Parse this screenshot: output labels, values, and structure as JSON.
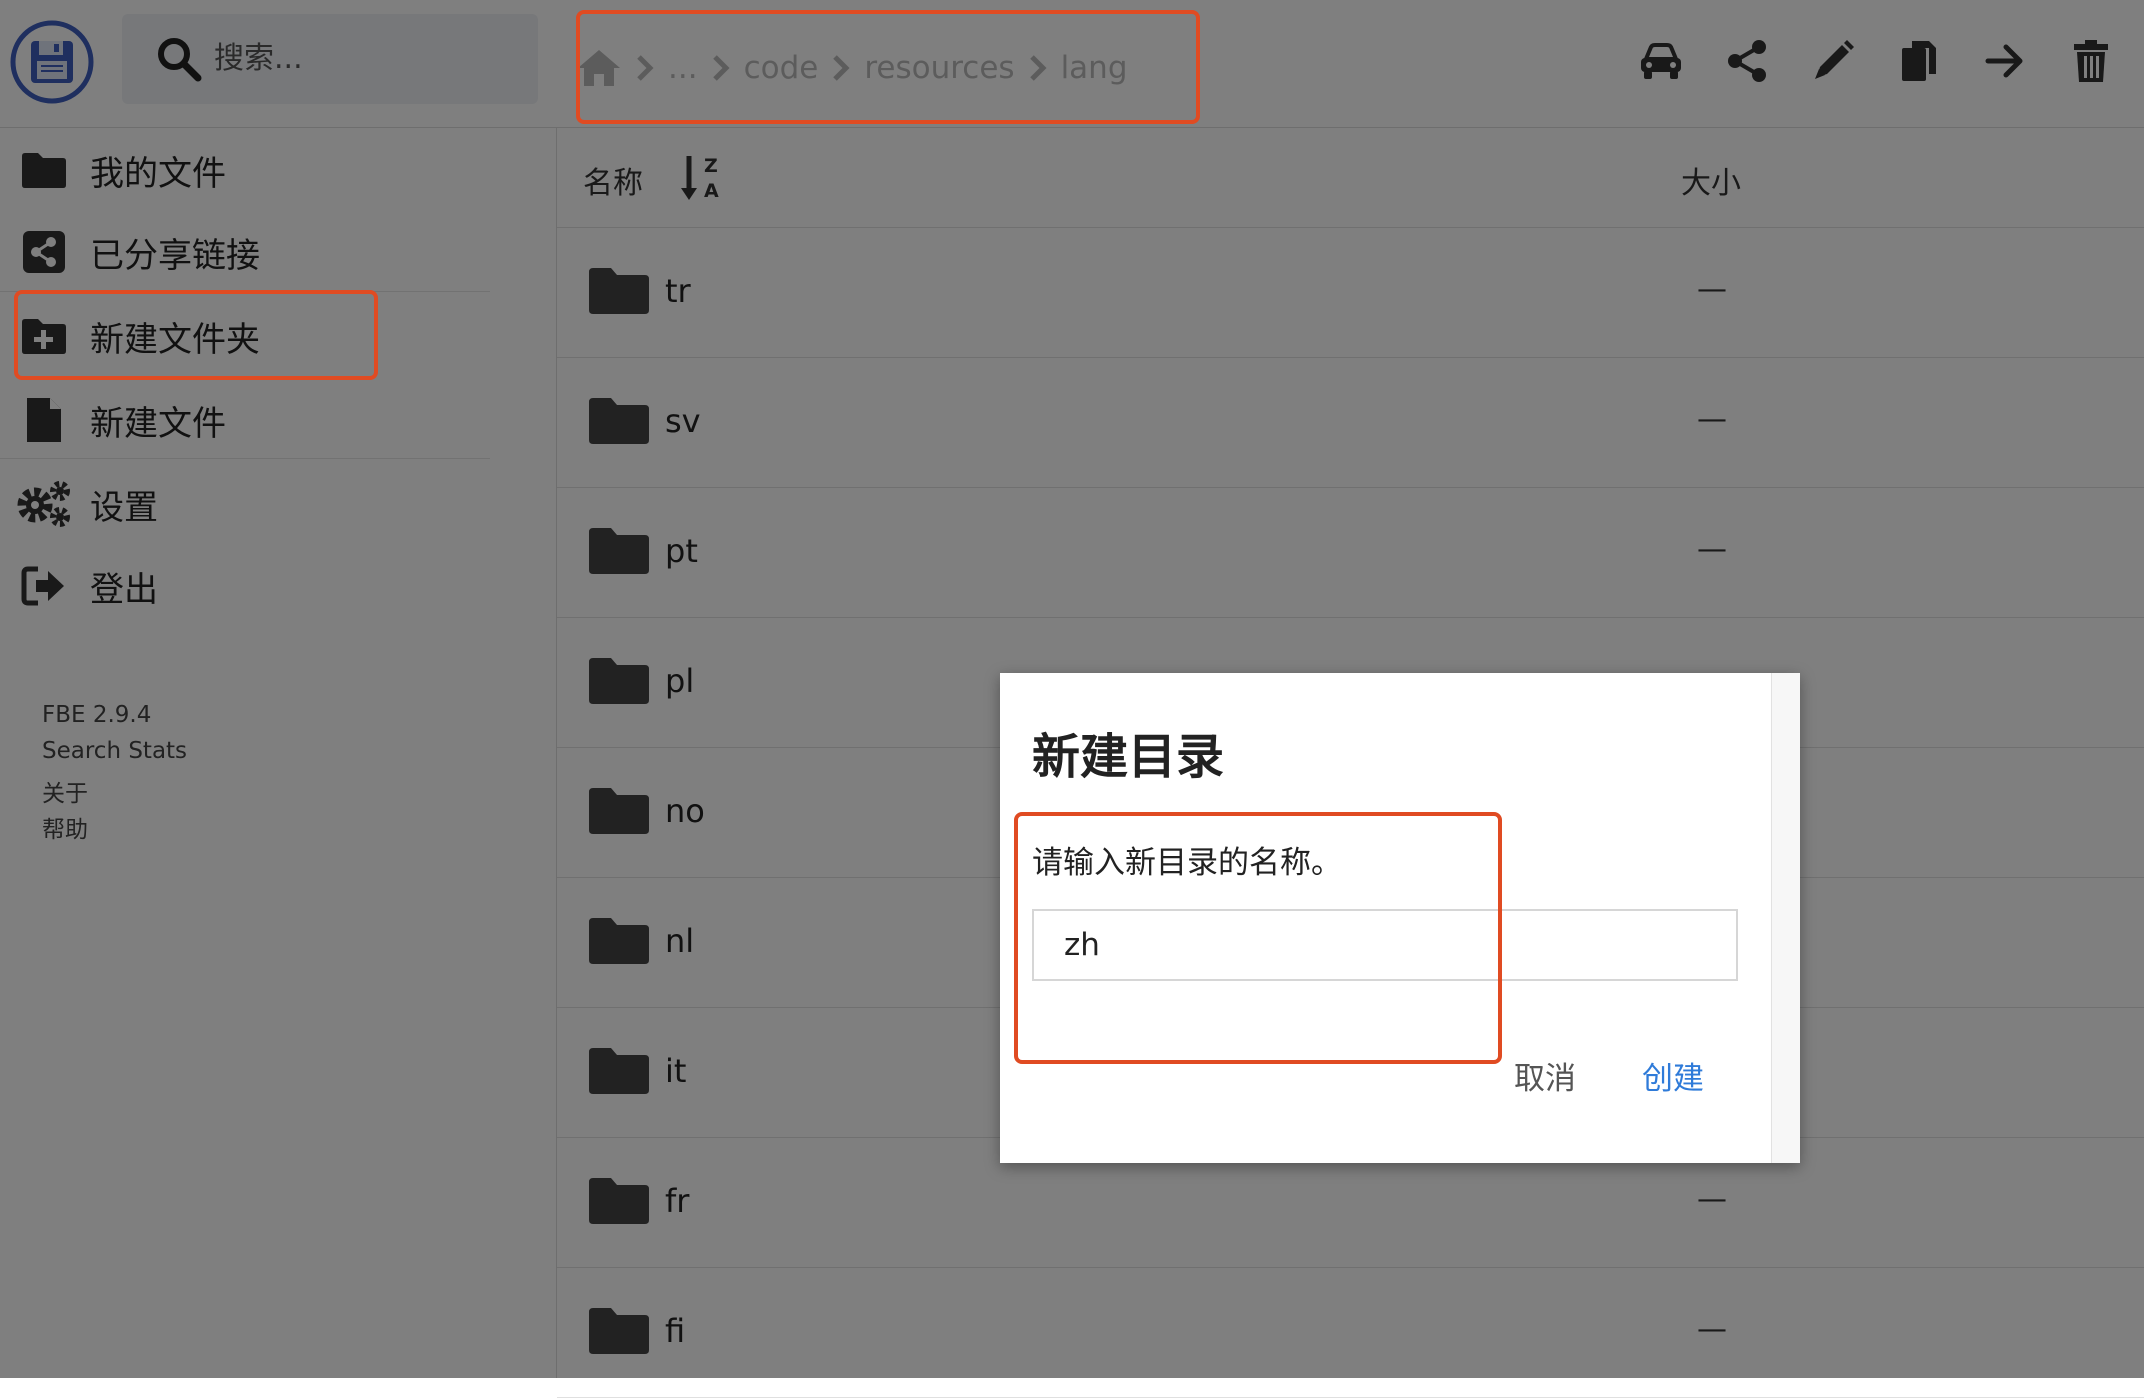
{
  "search": {
    "placeholder": "搜索..."
  },
  "breadcrumb": {
    "home_icon": "home-icon",
    "items": [
      "...",
      "code",
      "resources",
      "lang"
    ]
  },
  "toolbar": {
    "icons": [
      "car-icon",
      "share-icon",
      "pencil-icon",
      "copy-icon",
      "arrow-right-icon",
      "trash-icon"
    ]
  },
  "sidebar": {
    "items": [
      {
        "label": "我的文件",
        "icon": "folder-icon"
      },
      {
        "label": "已分享链接",
        "icon": "share-icon"
      },
      {
        "label": "新建文件夹",
        "icon": "folder-plus-icon"
      },
      {
        "label": "新建文件",
        "icon": "file-icon"
      },
      {
        "label": "设置",
        "icon": "gears-icon"
      },
      {
        "label": "登出",
        "icon": "sign-out-icon"
      }
    ],
    "footer": {
      "version": "FBE 2.9.4",
      "stats": "Search Stats",
      "about": "关于",
      "help": "帮助"
    }
  },
  "list": {
    "col_name": "名称",
    "col_size": "大小",
    "rows": [
      {
        "name": "tr",
        "size": "—"
      },
      {
        "name": "sv",
        "size": "—"
      },
      {
        "name": "pt",
        "size": "—"
      },
      {
        "name": "pl",
        "size": "—"
      },
      {
        "name": "no",
        "size": "—"
      },
      {
        "name": "nl",
        "size": "—"
      },
      {
        "name": "it",
        "size": "—"
      },
      {
        "name": "fr",
        "size": "—"
      },
      {
        "name": "fi",
        "size": "—"
      }
    ]
  },
  "dialog": {
    "title": "新建目录",
    "message": "请输入新目录的名称。",
    "input_value": "zh",
    "cancel": "取消",
    "create": "创建"
  },
  "colors": {
    "accent": "#2f7bd9",
    "highlight": "#e04b22",
    "folder": "#444444",
    "overlay": "rgba(0,0,0,0.5)"
  }
}
